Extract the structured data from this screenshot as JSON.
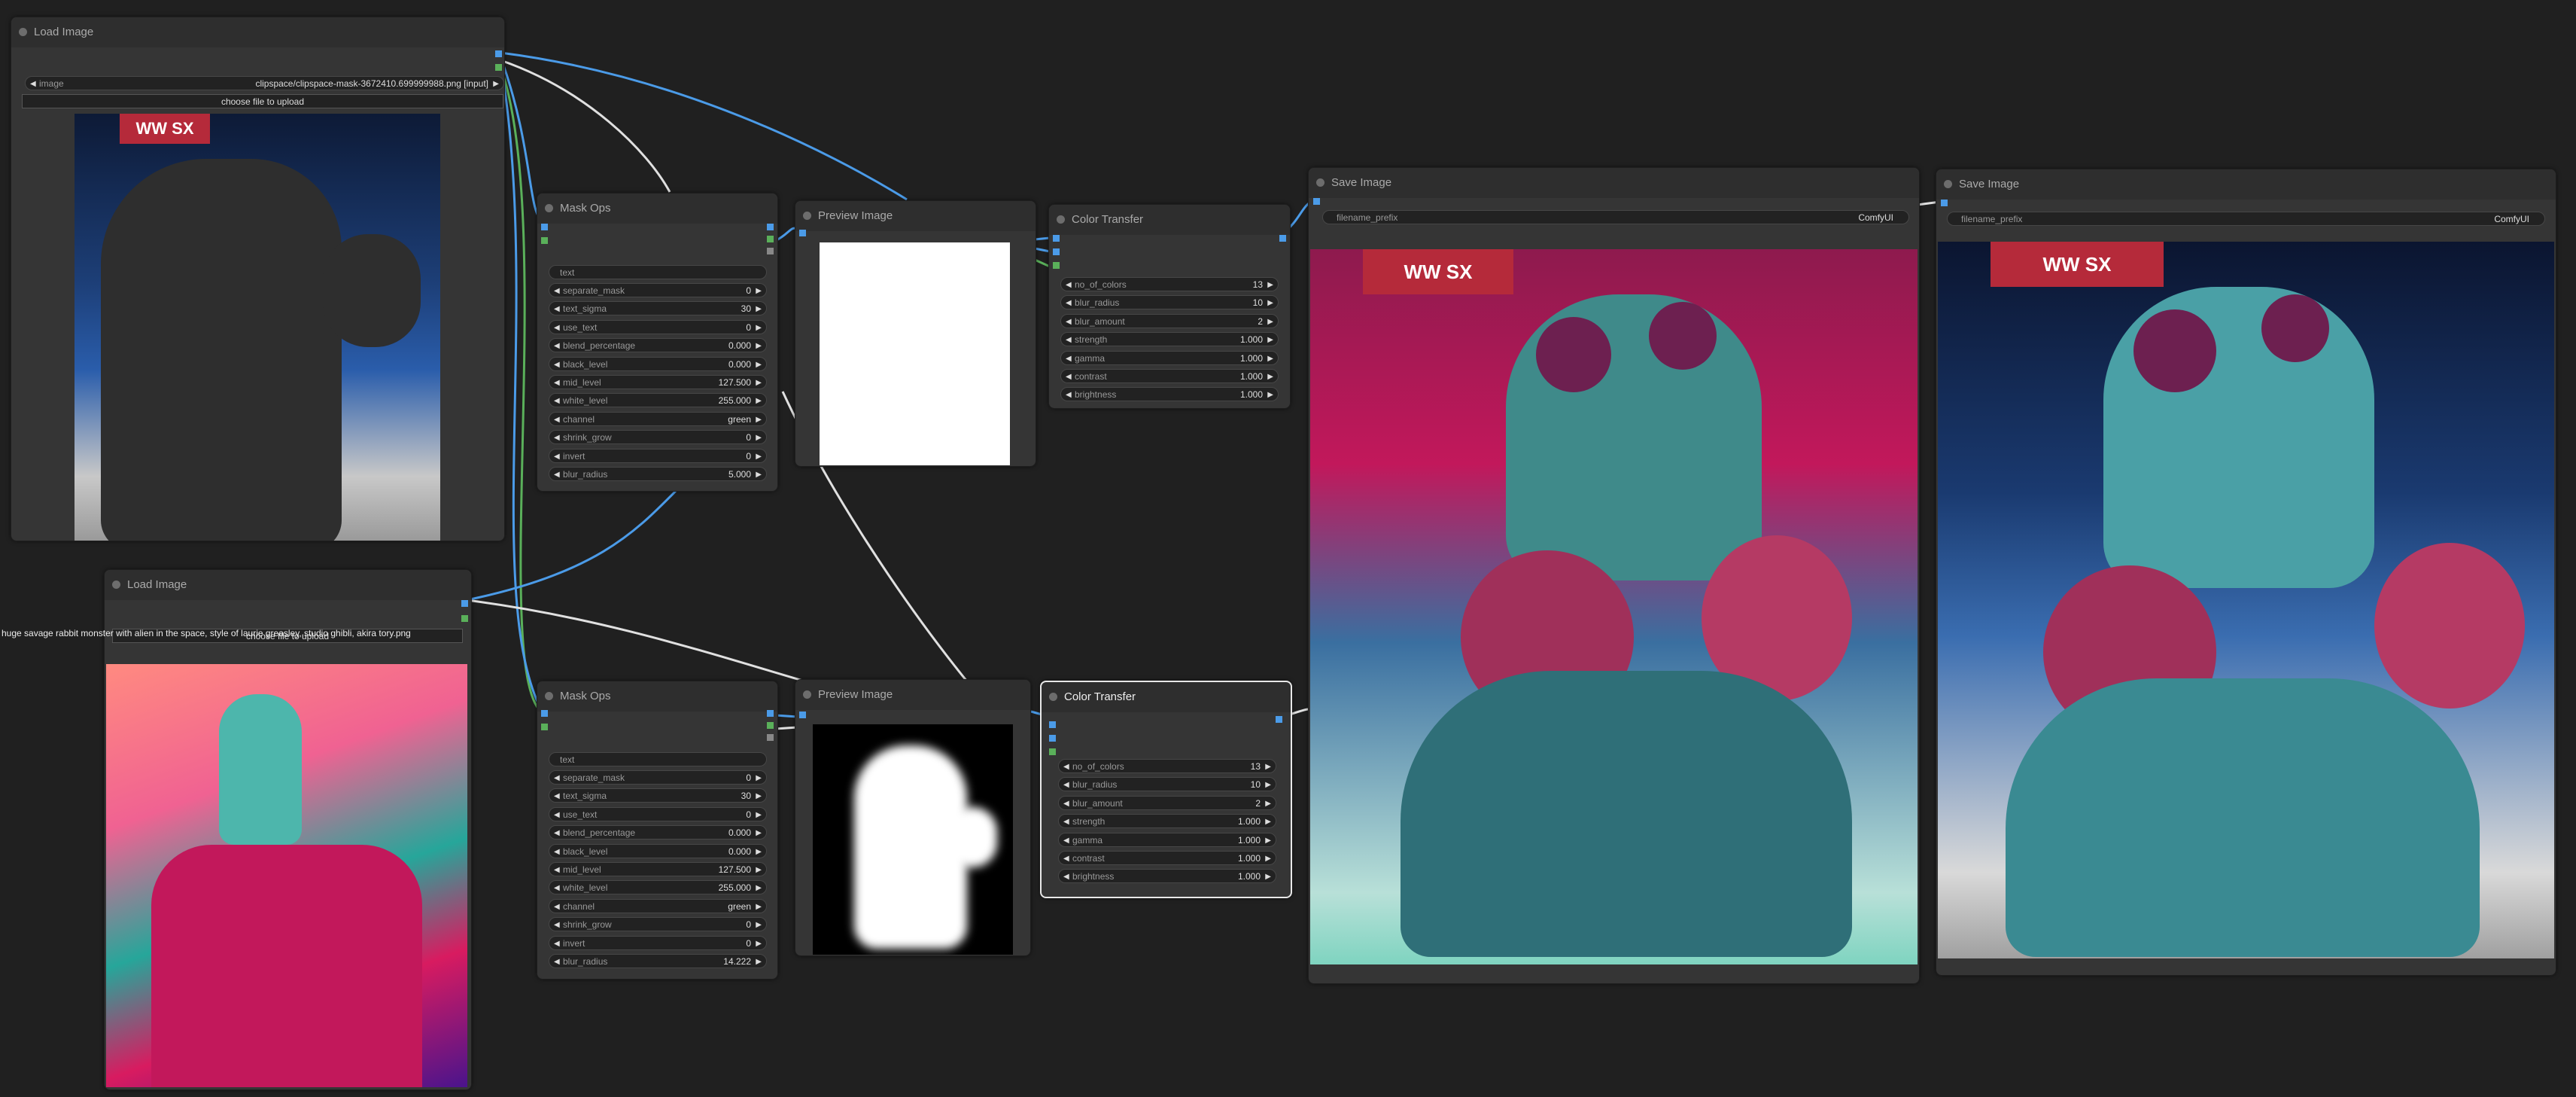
{
  "nodes": {
    "load_image_1": {
      "title": "Load Image",
      "image_label": "image",
      "image_value": "clipspace/clipspace-mask-3672410.699999988.png [input]",
      "upload_label": "choose file to upload"
    },
    "load_image_2": {
      "title": "Load Image",
      "image_value": "huge savage rabbit monster with alien in the space, style of laurie greasley, studio ghibli, akira tory.png",
      "upload_label": "choose file to upload"
    },
    "mask_ops_1": {
      "title": "Mask Ops",
      "text_placeholder": "text",
      "widgets": [
        {
          "label": "separate_mask",
          "value": "0"
        },
        {
          "label": "text_sigma",
          "value": "30"
        },
        {
          "label": "use_text",
          "value": "0"
        },
        {
          "label": "blend_percentage",
          "value": "0.000"
        },
        {
          "label": "black_level",
          "value": "0.000"
        },
        {
          "label": "mid_level",
          "value": "127.500"
        },
        {
          "label": "white_level",
          "value": "255.000"
        },
        {
          "label": "channel",
          "value": "green"
        },
        {
          "label": "shrink_grow",
          "value": "0"
        },
        {
          "label": "invert",
          "value": "0"
        },
        {
          "label": "blur_radius",
          "value": "5.000"
        }
      ]
    },
    "mask_ops_2": {
      "title": "Mask Ops",
      "text_placeholder": "text",
      "widgets": [
        {
          "label": "separate_mask",
          "value": "0"
        },
        {
          "label": "text_sigma",
          "value": "30"
        },
        {
          "label": "use_text",
          "value": "0"
        },
        {
          "label": "blend_percentage",
          "value": "0.000"
        },
        {
          "label": "black_level",
          "value": "0.000"
        },
        {
          "label": "mid_level",
          "value": "127.500"
        },
        {
          "label": "white_level",
          "value": "255.000"
        },
        {
          "label": "channel",
          "value": "green"
        },
        {
          "label": "shrink_grow",
          "value": "0"
        },
        {
          "label": "invert",
          "value": "0"
        },
        {
          "label": "blur_radius",
          "value": "14.222"
        }
      ]
    },
    "preview_1": {
      "title": "Preview Image"
    },
    "preview_2": {
      "title": "Preview Image"
    },
    "color_transfer_1": {
      "title": "Color Transfer",
      "widgets": [
        {
          "label": "no_of_colors",
          "value": "13"
        },
        {
          "label": "blur_radius",
          "value": "10"
        },
        {
          "label": "blur_amount",
          "value": "2"
        },
        {
          "label": "strength",
          "value": "1.000"
        },
        {
          "label": "gamma",
          "value": "1.000"
        },
        {
          "label": "contrast",
          "value": "1.000"
        },
        {
          "label": "brightness",
          "value": "1.000"
        }
      ]
    },
    "color_transfer_2": {
      "title": "Color Transfer",
      "widgets": [
        {
          "label": "no_of_colors",
          "value": "13"
        },
        {
          "label": "blur_radius",
          "value": "10"
        },
        {
          "label": "blur_amount",
          "value": "2"
        },
        {
          "label": "strength",
          "value": "1.000"
        },
        {
          "label": "gamma",
          "value": "1.000"
        },
        {
          "label": "contrast",
          "value": "1.000"
        },
        {
          "label": "brightness",
          "value": "1.000"
        }
      ]
    },
    "save_image_1": {
      "title": "Save Image",
      "prefix_label": "filename_prefix",
      "prefix_value": "ComfyUI"
    },
    "save_image_2": {
      "title": "Save Image",
      "prefix_label": "filename_prefix",
      "prefix_value": "ComfyUI"
    }
  },
  "images": {
    "frog_banner": "WW SX"
  },
  "colors": {
    "canvas": "#202020",
    "node_body": "#353535",
    "node_title": "#2e2e2e",
    "wire_image": "#4b9be8",
    "wire_mask": "#5ab05a",
    "wire_white": "#e0e0e0"
  }
}
